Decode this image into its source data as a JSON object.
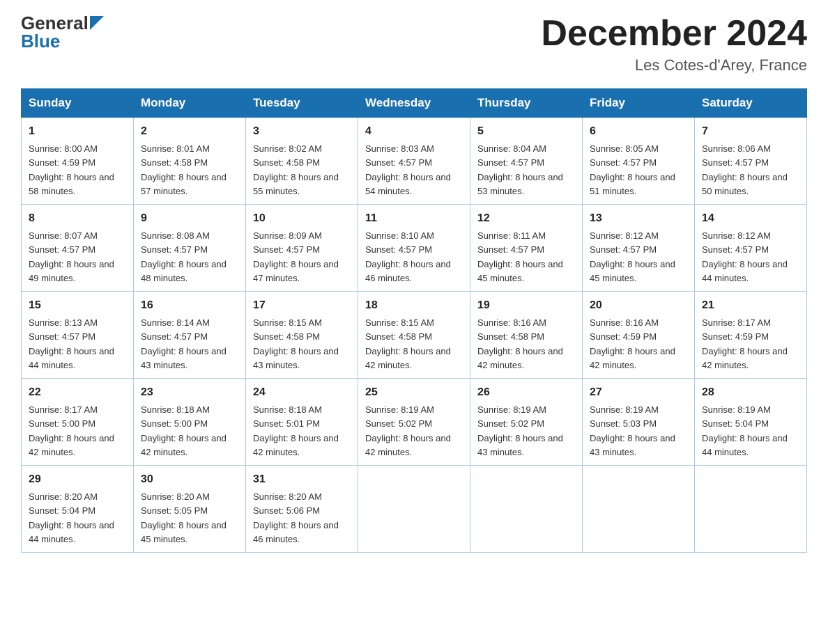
{
  "header": {
    "logo_general": "General",
    "logo_blue": "Blue",
    "title": "December 2024",
    "location": "Les Cotes-d'Arey, France"
  },
  "days_of_week": [
    "Sunday",
    "Monday",
    "Tuesday",
    "Wednesday",
    "Thursday",
    "Friday",
    "Saturday"
  ],
  "weeks": [
    [
      {
        "day": "1",
        "sunrise": "8:00 AM",
        "sunset": "4:59 PM",
        "daylight": "8 hours and 58 minutes."
      },
      {
        "day": "2",
        "sunrise": "8:01 AM",
        "sunset": "4:58 PM",
        "daylight": "8 hours and 57 minutes."
      },
      {
        "day": "3",
        "sunrise": "8:02 AM",
        "sunset": "4:58 PM",
        "daylight": "8 hours and 55 minutes."
      },
      {
        "day": "4",
        "sunrise": "8:03 AM",
        "sunset": "4:57 PM",
        "daylight": "8 hours and 54 minutes."
      },
      {
        "day": "5",
        "sunrise": "8:04 AM",
        "sunset": "4:57 PM",
        "daylight": "8 hours and 53 minutes."
      },
      {
        "day": "6",
        "sunrise": "8:05 AM",
        "sunset": "4:57 PM",
        "daylight": "8 hours and 51 minutes."
      },
      {
        "day": "7",
        "sunrise": "8:06 AM",
        "sunset": "4:57 PM",
        "daylight": "8 hours and 50 minutes."
      }
    ],
    [
      {
        "day": "8",
        "sunrise": "8:07 AM",
        "sunset": "4:57 PM",
        "daylight": "8 hours and 49 minutes."
      },
      {
        "day": "9",
        "sunrise": "8:08 AM",
        "sunset": "4:57 PM",
        "daylight": "8 hours and 48 minutes."
      },
      {
        "day": "10",
        "sunrise": "8:09 AM",
        "sunset": "4:57 PM",
        "daylight": "8 hours and 47 minutes."
      },
      {
        "day": "11",
        "sunrise": "8:10 AM",
        "sunset": "4:57 PM",
        "daylight": "8 hours and 46 minutes."
      },
      {
        "day": "12",
        "sunrise": "8:11 AM",
        "sunset": "4:57 PM",
        "daylight": "8 hours and 45 minutes."
      },
      {
        "day": "13",
        "sunrise": "8:12 AM",
        "sunset": "4:57 PM",
        "daylight": "8 hours and 45 minutes."
      },
      {
        "day": "14",
        "sunrise": "8:12 AM",
        "sunset": "4:57 PM",
        "daylight": "8 hours and 44 minutes."
      }
    ],
    [
      {
        "day": "15",
        "sunrise": "8:13 AM",
        "sunset": "4:57 PM",
        "daylight": "8 hours and 44 minutes."
      },
      {
        "day": "16",
        "sunrise": "8:14 AM",
        "sunset": "4:57 PM",
        "daylight": "8 hours and 43 minutes."
      },
      {
        "day": "17",
        "sunrise": "8:15 AM",
        "sunset": "4:58 PM",
        "daylight": "8 hours and 43 minutes."
      },
      {
        "day": "18",
        "sunrise": "8:15 AM",
        "sunset": "4:58 PM",
        "daylight": "8 hours and 42 minutes."
      },
      {
        "day": "19",
        "sunrise": "8:16 AM",
        "sunset": "4:58 PM",
        "daylight": "8 hours and 42 minutes."
      },
      {
        "day": "20",
        "sunrise": "8:16 AM",
        "sunset": "4:59 PM",
        "daylight": "8 hours and 42 minutes."
      },
      {
        "day": "21",
        "sunrise": "8:17 AM",
        "sunset": "4:59 PM",
        "daylight": "8 hours and 42 minutes."
      }
    ],
    [
      {
        "day": "22",
        "sunrise": "8:17 AM",
        "sunset": "5:00 PM",
        "daylight": "8 hours and 42 minutes."
      },
      {
        "day": "23",
        "sunrise": "8:18 AM",
        "sunset": "5:00 PM",
        "daylight": "8 hours and 42 minutes."
      },
      {
        "day": "24",
        "sunrise": "8:18 AM",
        "sunset": "5:01 PM",
        "daylight": "8 hours and 42 minutes."
      },
      {
        "day": "25",
        "sunrise": "8:19 AM",
        "sunset": "5:02 PM",
        "daylight": "8 hours and 42 minutes."
      },
      {
        "day": "26",
        "sunrise": "8:19 AM",
        "sunset": "5:02 PM",
        "daylight": "8 hours and 43 minutes."
      },
      {
        "day": "27",
        "sunrise": "8:19 AM",
        "sunset": "5:03 PM",
        "daylight": "8 hours and 43 minutes."
      },
      {
        "day": "28",
        "sunrise": "8:19 AM",
        "sunset": "5:04 PM",
        "daylight": "8 hours and 44 minutes."
      }
    ],
    [
      {
        "day": "29",
        "sunrise": "8:20 AM",
        "sunset": "5:04 PM",
        "daylight": "8 hours and 44 minutes."
      },
      {
        "day": "30",
        "sunrise": "8:20 AM",
        "sunset": "5:05 PM",
        "daylight": "8 hours and 45 minutes."
      },
      {
        "day": "31",
        "sunrise": "8:20 AM",
        "sunset": "5:06 PM",
        "daylight": "8 hours and 46 minutes."
      },
      null,
      null,
      null,
      null
    ]
  ],
  "labels": {
    "sunrise": "Sunrise:",
    "sunset": "Sunset:",
    "daylight": "Daylight:"
  }
}
